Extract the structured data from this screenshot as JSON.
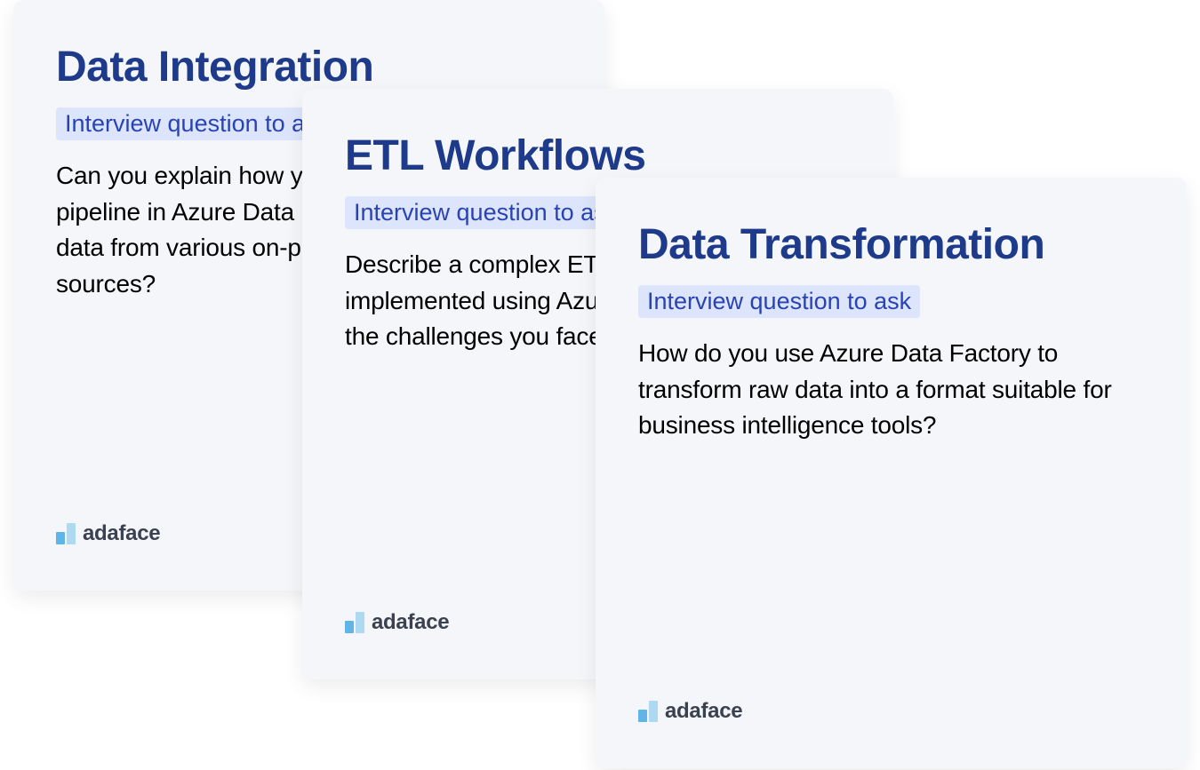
{
  "cards": [
    {
      "title": "Data Integration",
      "subtitle": "Interview question to ask",
      "body": "Can you explain how you would set up a pipeline in Azure Data Factory to integrate data from various on-premises and cloud sources?"
    },
    {
      "title": "ETL Workflows",
      "subtitle": "Interview question to ask",
      "body": "Describe a complex ETL workflow you have implemented using Azure Data Factory and the challenges you faced."
    },
    {
      "title": "Data Transformation",
      "subtitle": "Interview question to ask",
      "body": "How do you use Azure Data Factory to transform raw data into a format suitable for business intelligence tools?"
    }
  ],
  "brand": "adaface"
}
